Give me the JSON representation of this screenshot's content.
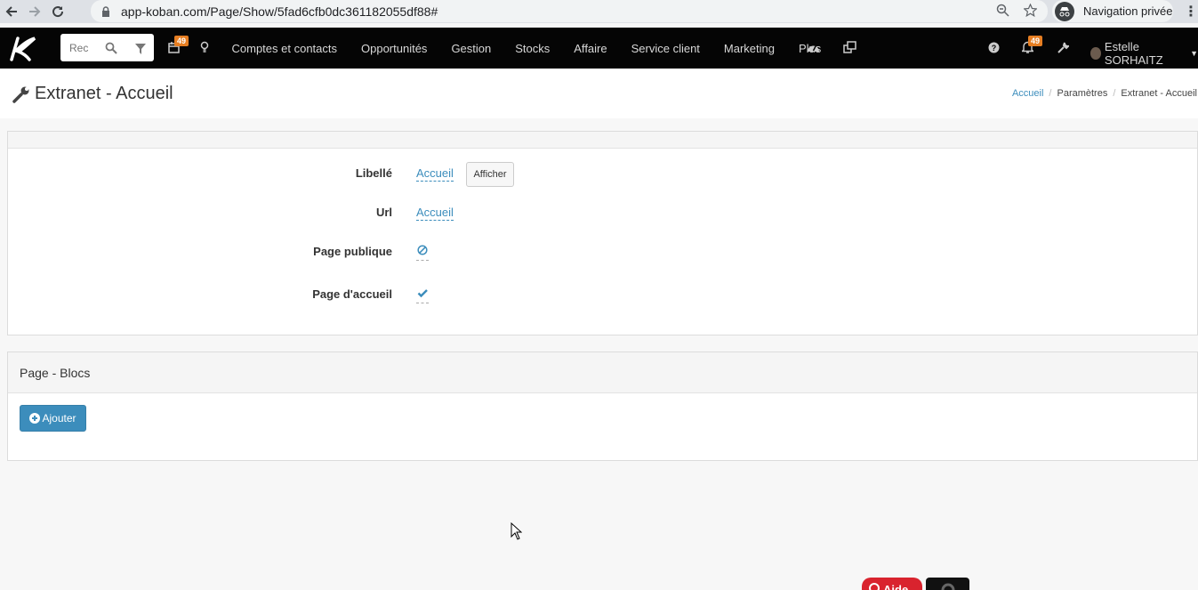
{
  "browser": {
    "url": "app-koban.com/Page/Show/5fad6cfb0dc361182055df88#",
    "incognito_label": "Navigation privée"
  },
  "topbar": {
    "search_placeholder": "Rec",
    "calendar_badge": "49",
    "menu": [
      "Comptes et contacts",
      "Opportunités",
      "Gestion",
      "Stocks",
      "Affaire",
      "Service client",
      "Marketing",
      "Plus"
    ],
    "notif_badge": "49",
    "user_name": "Estelle SORHAITZ"
  },
  "page": {
    "title": "Extranet - Accueil",
    "breadcrumb": [
      "Accueil",
      "Paramètres",
      "Extranet - Accueil"
    ]
  },
  "details": {
    "libelle_label": "Libellé",
    "libelle_value": "Accueil",
    "afficher_label": "Afficher",
    "url_label": "Url",
    "url_value": "Accueil",
    "public_label": "Page publique",
    "public_value": false,
    "home_label": "Page d'accueil",
    "home_value": true
  },
  "blocs": {
    "title": "Page - Blocs",
    "add_label": "Ajouter"
  },
  "footer": {
    "aide_label": "Aide"
  },
  "colors": {
    "link": "#3c8dbc",
    "topbar": "#050505",
    "badge": "#e67e22",
    "aide": "#d9232e"
  }
}
